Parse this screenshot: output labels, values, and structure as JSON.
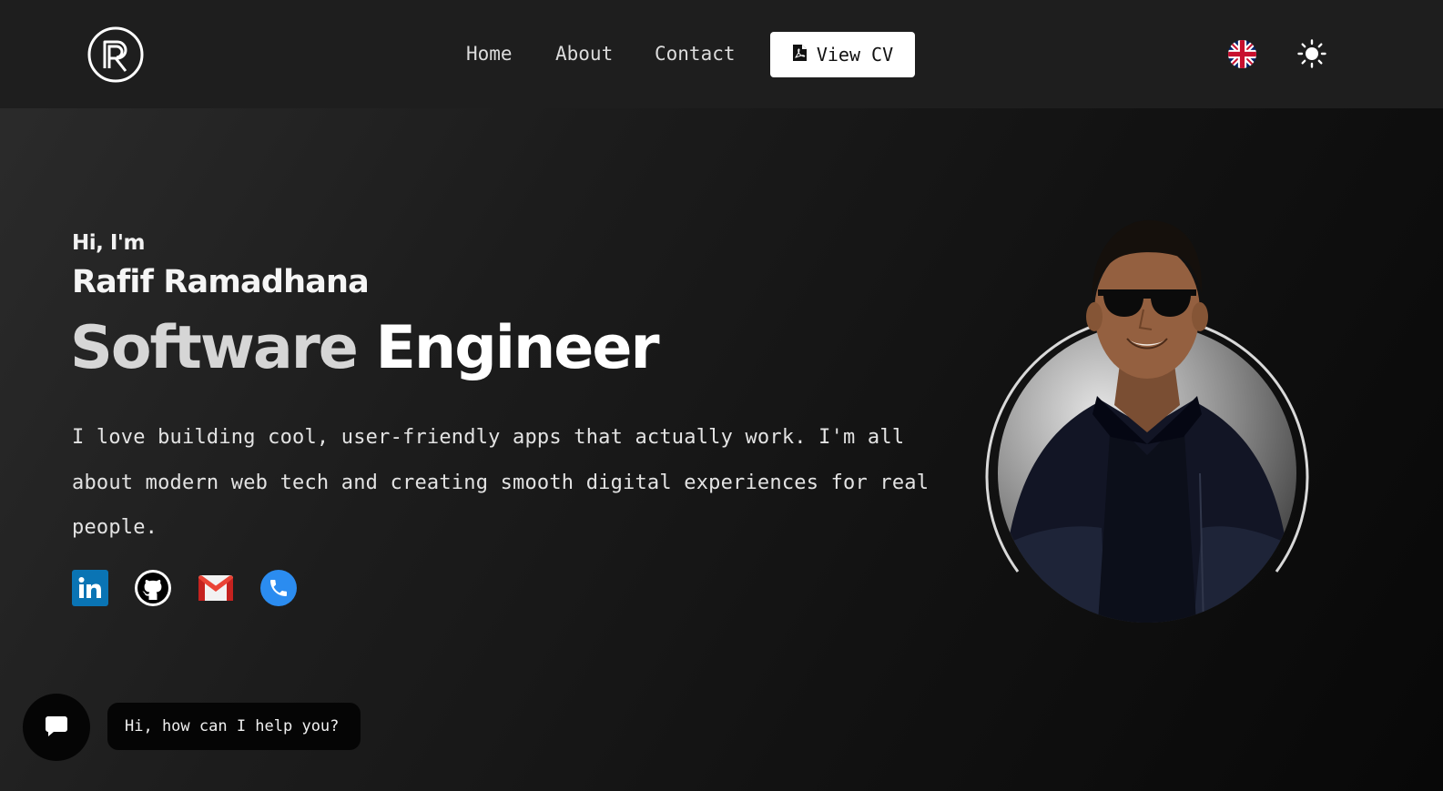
{
  "header": {
    "logo_alt": "R",
    "nav": {
      "home": "Home",
      "about": "About",
      "contact": "Contact"
    },
    "cv_button": "View CV",
    "cv_icon": "pdf-file-icon",
    "language_icon": "uk-flag-icon",
    "theme_icon": "sun-icon"
  },
  "hero": {
    "greeting": "Hi, I'm",
    "name": "Rafif Ramadhana",
    "role_word_1": "Software",
    "role_word_2": "Engineer",
    "description": "I love building cool, user-friendly apps that actually work. I'm all about modern web tech and creating smooth digital experiences for real people."
  },
  "socials": [
    {
      "icon": "linkedin-icon",
      "color": "#0a74b4"
    },
    {
      "icon": "github-icon",
      "color": "#000000"
    },
    {
      "icon": "gmail-icon",
      "color": "#ea4335"
    },
    {
      "icon": "phone-icon",
      "color": "#2b8cf0"
    }
  ],
  "chat": {
    "icon": "chat-icon",
    "bubble_text": "Hi, how can I help you?"
  },
  "colors": {
    "header_bg": "#1e1e1e",
    "accent": "#ffffff"
  }
}
